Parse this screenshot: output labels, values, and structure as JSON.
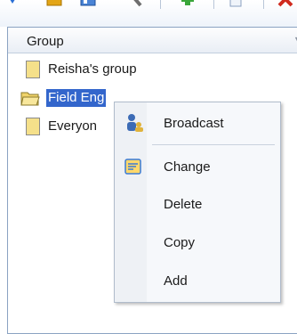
{
  "toolbar": {
    "icons": [
      "find-icon",
      "gold-box-icon",
      "window-icon",
      "wrench-icon",
      "add-user-icon",
      "document-icon",
      "delete-icon"
    ]
  },
  "grid": {
    "header": "Group",
    "rows": [
      {
        "label": "Reisha's group"
      },
      {
        "label": "Field Eng"
      },
      {
        "label": "Everyon"
      }
    ]
  },
  "context_menu": {
    "items": [
      {
        "label": "Broadcast",
        "icon": "users-broadcast-icon"
      },
      {
        "label": "Change",
        "icon": "edit-icon"
      },
      {
        "label": "Delete"
      },
      {
        "label": "Copy"
      },
      {
        "label": "Add"
      }
    ]
  },
  "colors": {
    "selection": "#3366cc",
    "folder": "#f5e08a",
    "border": "#8ba3c2"
  }
}
